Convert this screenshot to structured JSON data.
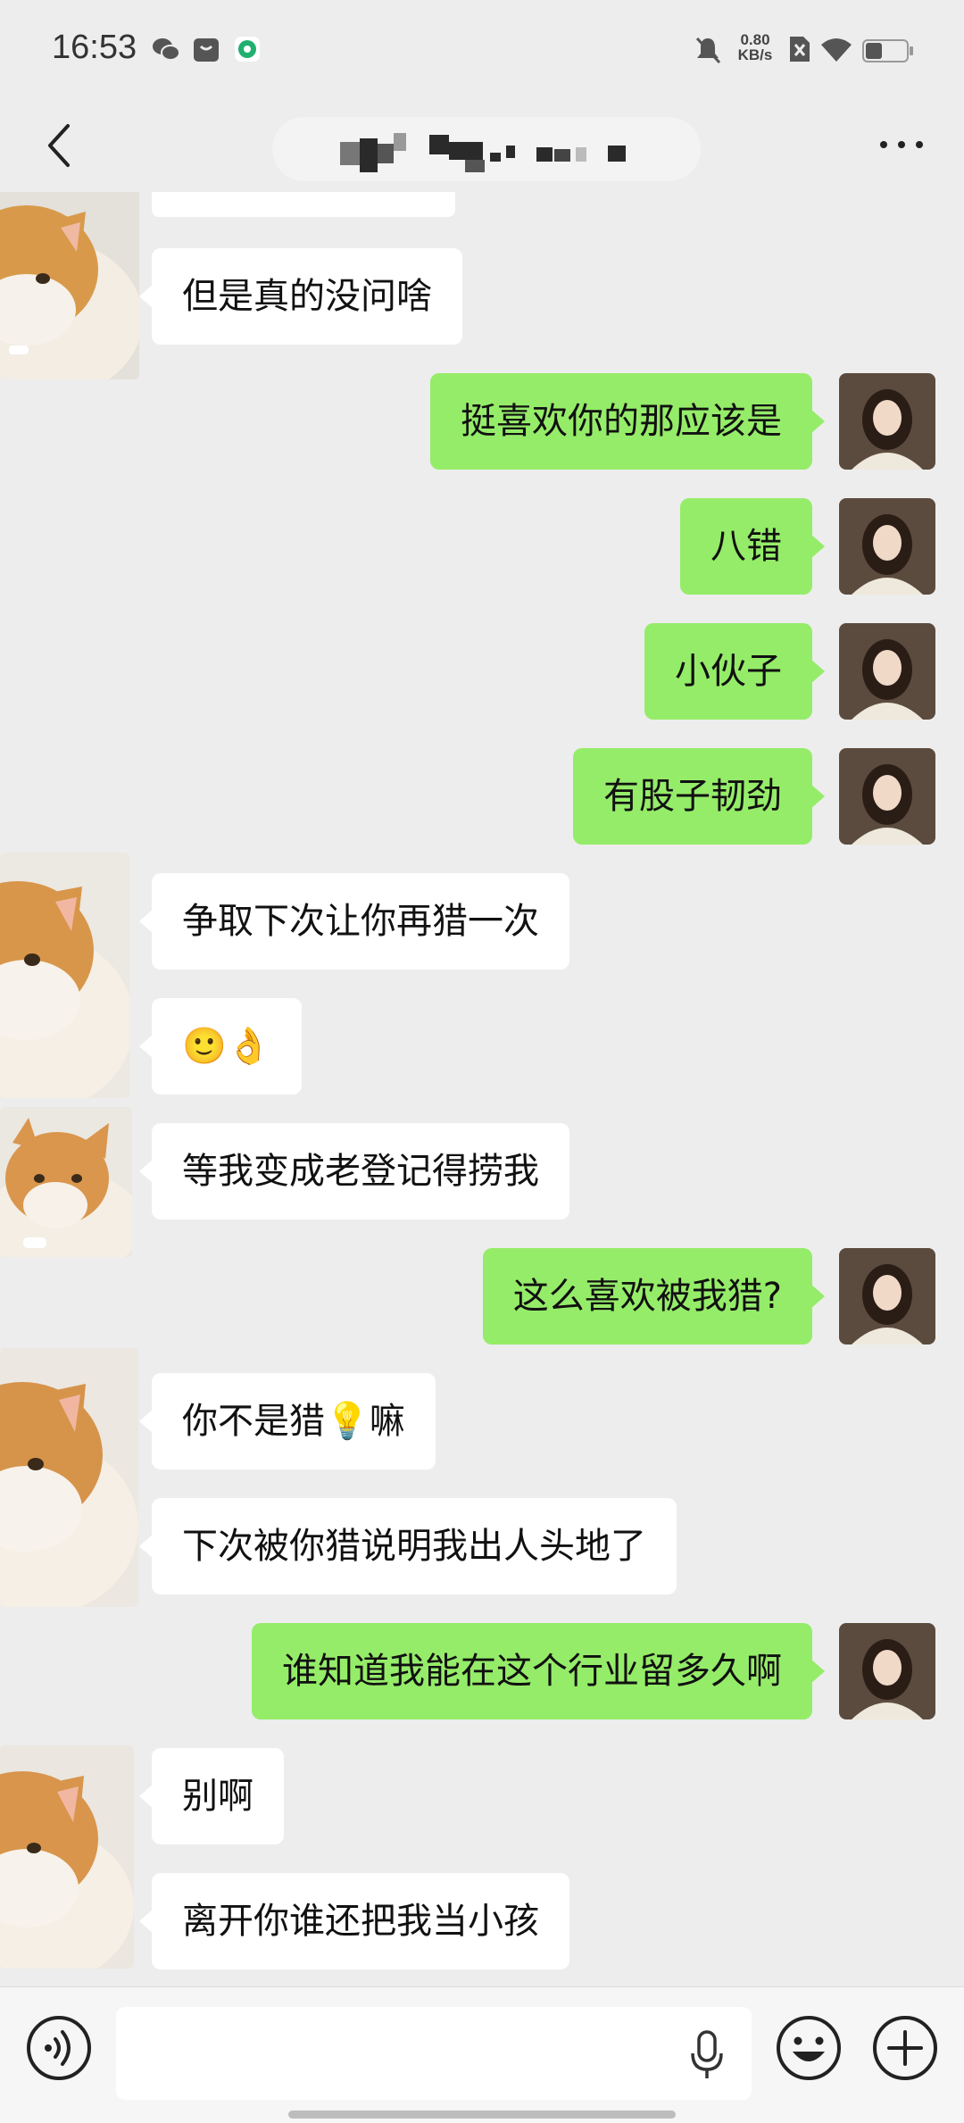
{
  "status_bar": {
    "time": "16:53",
    "net_speed_value": "0.80",
    "net_speed_unit": "KB/s",
    "icons": [
      "wechat-icon",
      "notification-icon",
      "app-icon",
      "mute-icon",
      "sim-off-icon",
      "wifi-icon",
      "battery-icon"
    ]
  },
  "header": {
    "title_pixelated": true,
    "back_icon": "chevron-left-icon",
    "more_icon": "more-dots-icon"
  },
  "messages": [
    {
      "side": "left",
      "text": "但是真的没问啥"
    },
    {
      "side": "right",
      "text": "挺喜欢你的那应该是"
    },
    {
      "side": "right",
      "text": "八错"
    },
    {
      "side": "right",
      "text": "小伙子"
    },
    {
      "side": "right",
      "text": "有股子韧劲"
    },
    {
      "side": "left",
      "text": "争取下次让你再猎一次"
    },
    {
      "side": "left",
      "text": "🙂👌"
    },
    {
      "side": "left",
      "text": "等我变成老登记得捞我"
    },
    {
      "side": "right",
      "text": "这么喜欢被我猎?"
    },
    {
      "side": "left",
      "text": "你不是猎💡嘛"
    },
    {
      "side": "left",
      "text": "下次被你猎说明我出人头地了"
    },
    {
      "side": "right",
      "text": "谁知道我能在这个行业留多久啊"
    },
    {
      "side": "left",
      "text": "别啊"
    },
    {
      "side": "left",
      "text": "离开你谁还把我当小孩"
    }
  ],
  "input_bar": {
    "voice_icon": "voice-icon",
    "mic_icon": "microphone-icon",
    "emoji_icon": "emoji-icon",
    "plus_icon": "plus-icon",
    "input_value": ""
  },
  "colors": {
    "background": "#ededed",
    "own_bubble": "#95ec69",
    "other_bubble": "#ffffff"
  }
}
